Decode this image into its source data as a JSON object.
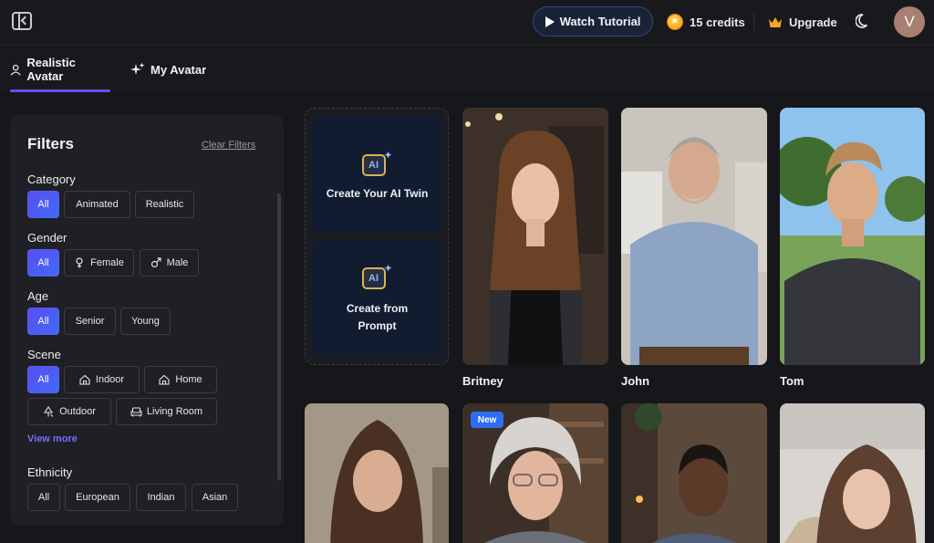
{
  "header": {
    "watch_tutorial": "Watch Tutorial",
    "credits": "15 credits",
    "upgrade": "Upgrade",
    "user_initial": "V"
  },
  "tabs": [
    {
      "label": "Realistic Avatar",
      "active": true
    },
    {
      "label": "My Avatar",
      "active": false
    }
  ],
  "filters": {
    "title": "Filters",
    "clear": "Clear Filters",
    "category": {
      "label": "Category",
      "options": [
        "All",
        "Animated",
        "Realistic"
      ],
      "selected": "All"
    },
    "gender": {
      "label": "Gender",
      "options": [
        "All",
        "Female",
        "Male"
      ],
      "selected": "All"
    },
    "age": {
      "label": "Age",
      "options": [
        "All",
        "Senior",
        "Young"
      ],
      "selected": "All"
    },
    "scene": {
      "label": "Scene",
      "options": [
        "All",
        "Indoor",
        "Home",
        "Outdoor",
        "Living Room"
      ],
      "selected": "All"
    },
    "view_more": "View more",
    "ethnicity": {
      "label": "Ethnicity",
      "options": [
        "All",
        "European",
        "Indian",
        "Asian"
      ]
    }
  },
  "create": {
    "twin": "Create Your AI Twin",
    "prompt_line1": "Create from",
    "prompt_line2": "Prompt",
    "icon_text": "AI"
  },
  "avatars": [
    {
      "name": "Britney"
    },
    {
      "name": "John"
    },
    {
      "name": "Tom"
    },
    {
      "name": ""
    },
    {
      "name": "",
      "badge": "New"
    },
    {
      "name": ""
    },
    {
      "name": ""
    }
  ],
  "colors": {
    "accent": "#6a4cf3",
    "badge": "#2f6df0",
    "background": "#16171b"
  }
}
